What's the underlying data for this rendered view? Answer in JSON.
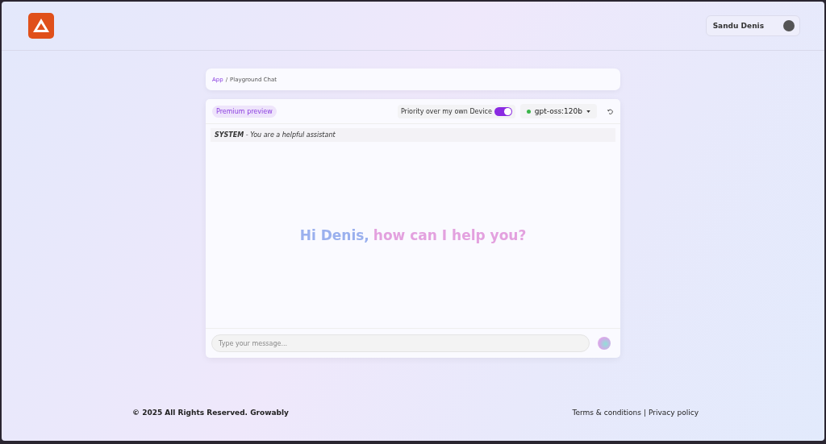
{
  "header": {
    "user_name": "Sandu Denis"
  },
  "breadcrumb": {
    "link": "App",
    "separator": "/",
    "current": "Playground Chat"
  },
  "chat": {
    "badge": "Premium preview",
    "priority_toggle": {
      "label": "Priority over my own Device",
      "on": true
    },
    "model": {
      "name": "gpt-oss:120b",
      "online": true
    },
    "system_prompt": {
      "label": "SYSTEM",
      "separator": "-",
      "text": "You are a helpful assistant"
    },
    "greeting": {
      "name_part": "Hi Denis,",
      "rest": "how can I help you?"
    },
    "input": {
      "placeholder": "Type your message..."
    }
  },
  "footer": {
    "copyright": "© 2025 All Rights Reserved. Growably",
    "links": [
      "Terms & conditions",
      "Privacy policy"
    ],
    "separator": "|"
  }
}
